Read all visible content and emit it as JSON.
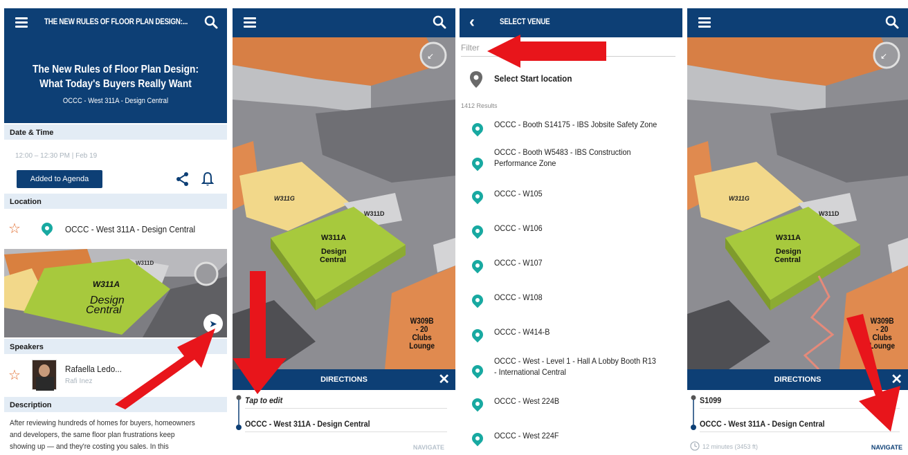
{
  "panel1": {
    "header_title": "THE NEW RULES OF FLOOR PLAN DESIGN:...",
    "session_title_line1": "The New Rules of Floor Plan Design:",
    "session_title_line2": "What Today's Buyers Really Want",
    "session_location": "OCCC - West 311A - Design Central",
    "date_time_label": "Date & Time",
    "date_time_value": "12:00 – 12:30 PM | Feb 19",
    "agenda_button": "Added to Agenda",
    "location_label": "Location",
    "location_value": "OCCC - West 311A - Design Central",
    "map_room": "W311A",
    "map_room_line1": "Design",
    "map_room_line2": "Central",
    "map_room_small1": "W311D",
    "speakers_label": "Speakers",
    "speaker_name": "Rafaella Ledo...",
    "speaker_company": "Rafi Inez",
    "description_label": "Description",
    "description_line1": "After reviewing hundreds of homes for buyers, homeowners",
    "description_line2": "and developers, the same floor plan frustrations keep",
    "description_line3": "showing up — and they're costing you sales. In this"
  },
  "panel2": {
    "room_w311g": "W311G",
    "room_w311d": "W311D",
    "room_w311a": "W311A",
    "room_design": "Design",
    "room_central": "Central",
    "room_w309b_1": "W309B",
    "room_w309b_2": "- 20",
    "room_w309b_3": "Clubs",
    "room_w309b_4": "Lounge",
    "directions_title": "DIRECTIONS",
    "start_placeholder": "Tap to edit",
    "destination": "OCCC - West 311A - Design Central",
    "navigate_label": "NAVIGATE"
  },
  "panel3": {
    "header_title": "SELECT VENUE",
    "filter_placeholder": "Filter",
    "select_start": "Select Start location",
    "results_count": "1412 Results",
    "venues": [
      "OCCC - Booth S14175 - IBS Jobsite Safety Zone",
      "OCCC - Booth W5483 - IBS Construction",
      "OCCC - W105",
      "OCCC - W106",
      "OCCC - W107",
      "OCCC - W108",
      "OCCC - W414-B",
      "OCCC - West - Level 1 - Hall A Lobby Booth R13",
      "OCCC - West 224B",
      "OCCC - West 224F"
    ],
    "venue_line2_booth": "Performance Zone",
    "venue_line2_hall": "- International Central"
  },
  "panel4": {
    "directions_title": "DIRECTIONS",
    "start": "S1099",
    "destination": "OCCC - West 311A - Design Central",
    "eta": "12 minutes (3453 ft)",
    "navigate_label": "NAVIGATE"
  },
  "colors": {
    "brand_navy": "#0d3f75",
    "teal_pin": "#18a9a1",
    "arrow_red": "#e8151b",
    "room_green": "#a7c93d",
    "room_orange": "#e08a4f",
    "room_yellow": "#f2d88a"
  }
}
